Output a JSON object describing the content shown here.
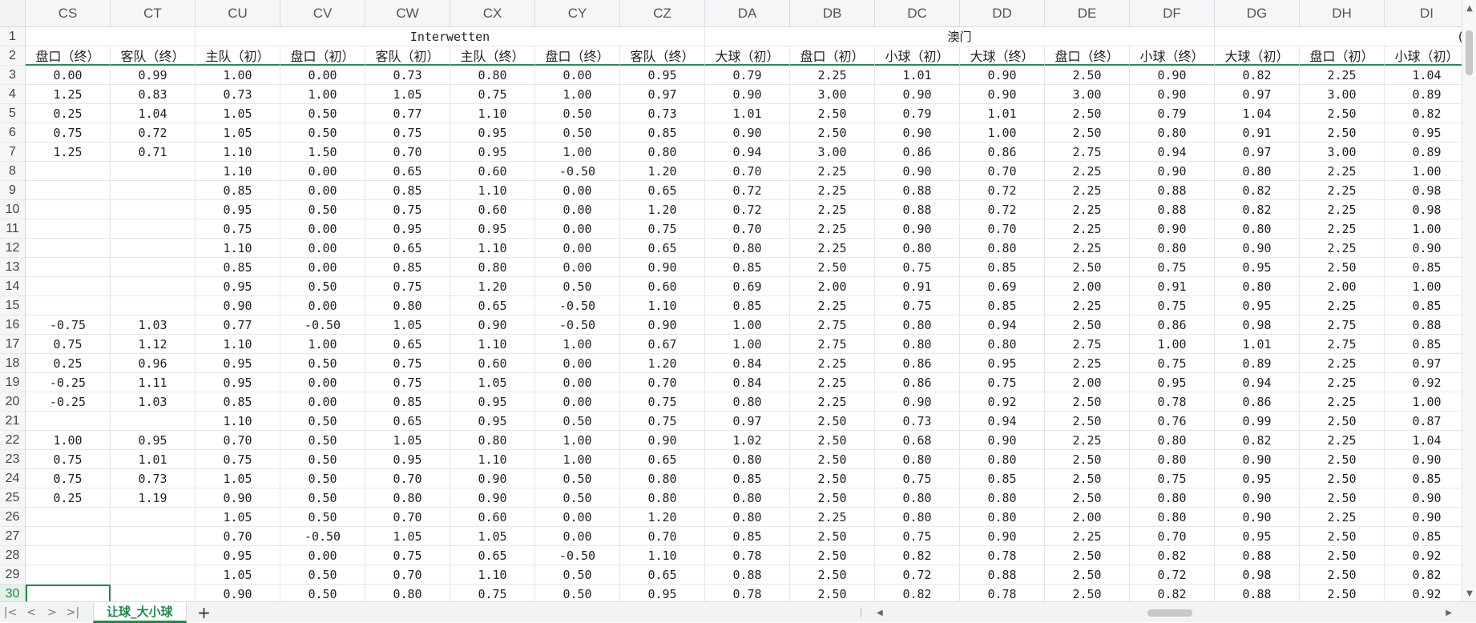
{
  "columns": [
    "CS",
    "CT",
    "CU",
    "CV",
    "CW",
    "CX",
    "CY",
    "CZ",
    "DA",
    "DB",
    "DC",
    "DD",
    "DE",
    "DF",
    "DG",
    "DH",
    "DI"
  ],
  "row_numbers": [
    "1",
    "2",
    "3",
    "4",
    "5",
    "6",
    "7",
    "8",
    "9",
    "10",
    "11",
    "12",
    "13",
    "14",
    "15",
    "16",
    "17",
    "18",
    "19",
    "20",
    "21",
    "22",
    "23",
    "24",
    "25",
    "26",
    "27",
    "28",
    "29",
    "30"
  ],
  "group_headers": {
    "interwetten": "Interwetten",
    "macau": "澳门",
    "next_partial": "("
  },
  "subheaders": [
    "盘口（终）",
    "客队（终）",
    "主队（初）",
    "盘口（初）",
    "客队（初）",
    "主队（终）",
    "盘口（终）",
    "客队（终）",
    "大球（初）",
    "盘口（初）",
    "小球（初）",
    "大球（终）",
    "盘口（终）",
    "小球（终）",
    "大球（初）",
    "盘口（初）",
    "小球（初）"
  ],
  "rows": [
    [
      "0.00",
      "0.99",
      "1.00",
      "0.00",
      "0.73",
      "0.80",
      "0.00",
      "0.95",
      "0.79",
      "2.25",
      "1.01",
      "0.90",
      "2.50",
      "0.90",
      "0.82",
      "2.25",
      "1.04"
    ],
    [
      "1.25",
      "0.83",
      "0.73",
      "1.00",
      "1.05",
      "0.75",
      "1.00",
      "0.97",
      "0.90",
      "3.00",
      "0.90",
      "0.90",
      "3.00",
      "0.90",
      "0.97",
      "3.00",
      "0.89"
    ],
    [
      "0.25",
      "1.04",
      "1.05",
      "0.50",
      "0.77",
      "1.10",
      "0.50",
      "0.73",
      "1.01",
      "2.50",
      "0.79",
      "1.01",
      "2.50",
      "0.79",
      "1.04",
      "2.50",
      "0.82"
    ],
    [
      "0.75",
      "0.72",
      "1.05",
      "0.50",
      "0.75",
      "0.95",
      "0.50",
      "0.85",
      "0.90",
      "2.50",
      "0.90",
      "1.00",
      "2.50",
      "0.80",
      "0.91",
      "2.50",
      "0.95"
    ],
    [
      "1.25",
      "0.71",
      "1.10",
      "1.50",
      "0.70",
      "0.95",
      "1.00",
      "0.80",
      "0.94",
      "3.00",
      "0.86",
      "0.86",
      "2.75",
      "0.94",
      "0.97",
      "3.00",
      "0.89"
    ],
    [
      "",
      "",
      "1.10",
      "0.00",
      "0.65",
      "0.60",
      "-0.50",
      "1.20",
      "0.70",
      "2.25",
      "0.90",
      "0.70",
      "2.25",
      "0.90",
      "0.80",
      "2.25",
      "1.00"
    ],
    [
      "",
      "",
      "0.85",
      "0.00",
      "0.85",
      "1.10",
      "0.00",
      "0.65",
      "0.72",
      "2.25",
      "0.88",
      "0.72",
      "2.25",
      "0.88",
      "0.82",
      "2.25",
      "0.98"
    ],
    [
      "",
      "",
      "0.95",
      "0.50",
      "0.75",
      "0.60",
      "0.00",
      "1.20",
      "0.72",
      "2.25",
      "0.88",
      "0.72",
      "2.25",
      "0.88",
      "0.82",
      "2.25",
      "0.98"
    ],
    [
      "",
      "",
      "0.75",
      "0.00",
      "0.95",
      "0.95",
      "0.00",
      "0.75",
      "0.70",
      "2.25",
      "0.90",
      "0.70",
      "2.25",
      "0.90",
      "0.80",
      "2.25",
      "1.00"
    ],
    [
      "",
      "",
      "1.10",
      "0.00",
      "0.65",
      "1.10",
      "0.00",
      "0.65",
      "0.80",
      "2.25",
      "0.80",
      "0.80",
      "2.25",
      "0.80",
      "0.90",
      "2.25",
      "0.90"
    ],
    [
      "",
      "",
      "0.85",
      "0.00",
      "0.85",
      "0.80",
      "0.00",
      "0.90",
      "0.85",
      "2.50",
      "0.75",
      "0.85",
      "2.50",
      "0.75",
      "0.95",
      "2.50",
      "0.85"
    ],
    [
      "",
      "",
      "0.95",
      "0.50",
      "0.75",
      "1.20",
      "0.50",
      "0.60",
      "0.69",
      "2.00",
      "0.91",
      "0.69",
      "2.00",
      "0.91",
      "0.80",
      "2.00",
      "1.00"
    ],
    [
      "",
      "",
      "0.90",
      "0.00",
      "0.80",
      "0.65",
      "-0.50",
      "1.10",
      "0.85",
      "2.25",
      "0.75",
      "0.85",
      "2.25",
      "0.75",
      "0.95",
      "2.25",
      "0.85"
    ],
    [
      "-0.75",
      "1.03",
      "0.77",
      "-0.50",
      "1.05",
      "0.90",
      "-0.50",
      "0.90",
      "1.00",
      "2.75",
      "0.80",
      "0.94",
      "2.50",
      "0.86",
      "0.98",
      "2.75",
      "0.88"
    ],
    [
      "0.75",
      "1.12",
      "1.10",
      "1.00",
      "0.65",
      "1.10",
      "1.00",
      "0.67",
      "1.00",
      "2.75",
      "0.80",
      "0.80",
      "2.75",
      "1.00",
      "1.01",
      "2.75",
      "0.85"
    ],
    [
      "0.25",
      "0.96",
      "0.95",
      "0.50",
      "0.75",
      "0.60",
      "0.00",
      "1.20",
      "0.84",
      "2.25",
      "0.86",
      "0.95",
      "2.25",
      "0.75",
      "0.89",
      "2.25",
      "0.97"
    ],
    [
      "-0.25",
      "1.11",
      "0.95",
      "0.00",
      "0.75",
      "1.05",
      "0.00",
      "0.70",
      "0.84",
      "2.25",
      "0.86",
      "0.75",
      "2.00",
      "0.95",
      "0.94",
      "2.25",
      "0.92"
    ],
    [
      "-0.25",
      "1.03",
      "0.85",
      "0.00",
      "0.85",
      "0.95",
      "0.00",
      "0.75",
      "0.80",
      "2.25",
      "0.90",
      "0.92",
      "2.50",
      "0.78",
      "0.86",
      "2.25",
      "1.00"
    ],
    [
      "",
      "",
      "1.10",
      "0.50",
      "0.65",
      "0.95",
      "0.50",
      "0.75",
      "0.97",
      "2.50",
      "0.73",
      "0.94",
      "2.50",
      "0.76",
      "0.99",
      "2.50",
      "0.87"
    ],
    [
      "1.00",
      "0.95",
      "0.70",
      "0.50",
      "1.05",
      "0.80",
      "1.00",
      "0.90",
      "1.02",
      "2.50",
      "0.68",
      "0.90",
      "2.25",
      "0.80",
      "0.82",
      "2.25",
      "1.04"
    ],
    [
      "0.75",
      "1.01",
      "0.75",
      "0.50",
      "0.95",
      "1.10",
      "1.00",
      "0.65",
      "0.80",
      "2.50",
      "0.80",
      "0.80",
      "2.50",
      "0.80",
      "0.90",
      "2.50",
      "0.90"
    ],
    [
      "0.75",
      "0.73",
      "1.05",
      "0.50",
      "0.70",
      "0.90",
      "0.50",
      "0.80",
      "0.85",
      "2.50",
      "0.75",
      "0.85",
      "2.50",
      "0.75",
      "0.95",
      "2.50",
      "0.85"
    ],
    [
      "0.25",
      "1.19",
      "0.90",
      "0.50",
      "0.80",
      "0.90",
      "0.50",
      "0.80",
      "0.80",
      "2.50",
      "0.80",
      "0.80",
      "2.50",
      "0.80",
      "0.90",
      "2.50",
      "0.90"
    ],
    [
      "",
      "",
      "1.05",
      "0.50",
      "0.70",
      "0.60",
      "0.00",
      "1.20",
      "0.80",
      "2.25",
      "0.80",
      "0.80",
      "2.00",
      "0.80",
      "0.90",
      "2.25",
      "0.90"
    ],
    [
      "",
      "",
      "0.70",
      "-0.50",
      "1.05",
      "1.05",
      "0.00",
      "0.70",
      "0.85",
      "2.50",
      "0.75",
      "0.90",
      "2.25",
      "0.70",
      "0.95",
      "2.50",
      "0.85"
    ],
    [
      "",
      "",
      "0.95",
      "0.00",
      "0.75",
      "0.65",
      "-0.50",
      "1.10",
      "0.78",
      "2.50",
      "0.82",
      "0.78",
      "2.50",
      "0.82",
      "0.88",
      "2.50",
      "0.92"
    ],
    [
      "",
      "",
      "1.05",
      "0.50",
      "0.70",
      "1.10",
      "0.50",
      "0.65",
      "0.88",
      "2.50",
      "0.72",
      "0.88",
      "2.50",
      "0.72",
      "0.98",
      "2.50",
      "0.82"
    ],
    [
      "",
      "",
      "0.90",
      "0.50",
      "0.80",
      "0.75",
      "0.50",
      "0.95",
      "0.78",
      "2.50",
      "0.82",
      "0.78",
      "2.50",
      "0.82",
      "0.88",
      "2.50",
      "0.92"
    ]
  ],
  "sheet_tab": "让球_大小球",
  "add_sheet": "+",
  "nav": {
    "first": "|<",
    "prev": "<",
    "next": ">",
    "last": ">|"
  }
}
